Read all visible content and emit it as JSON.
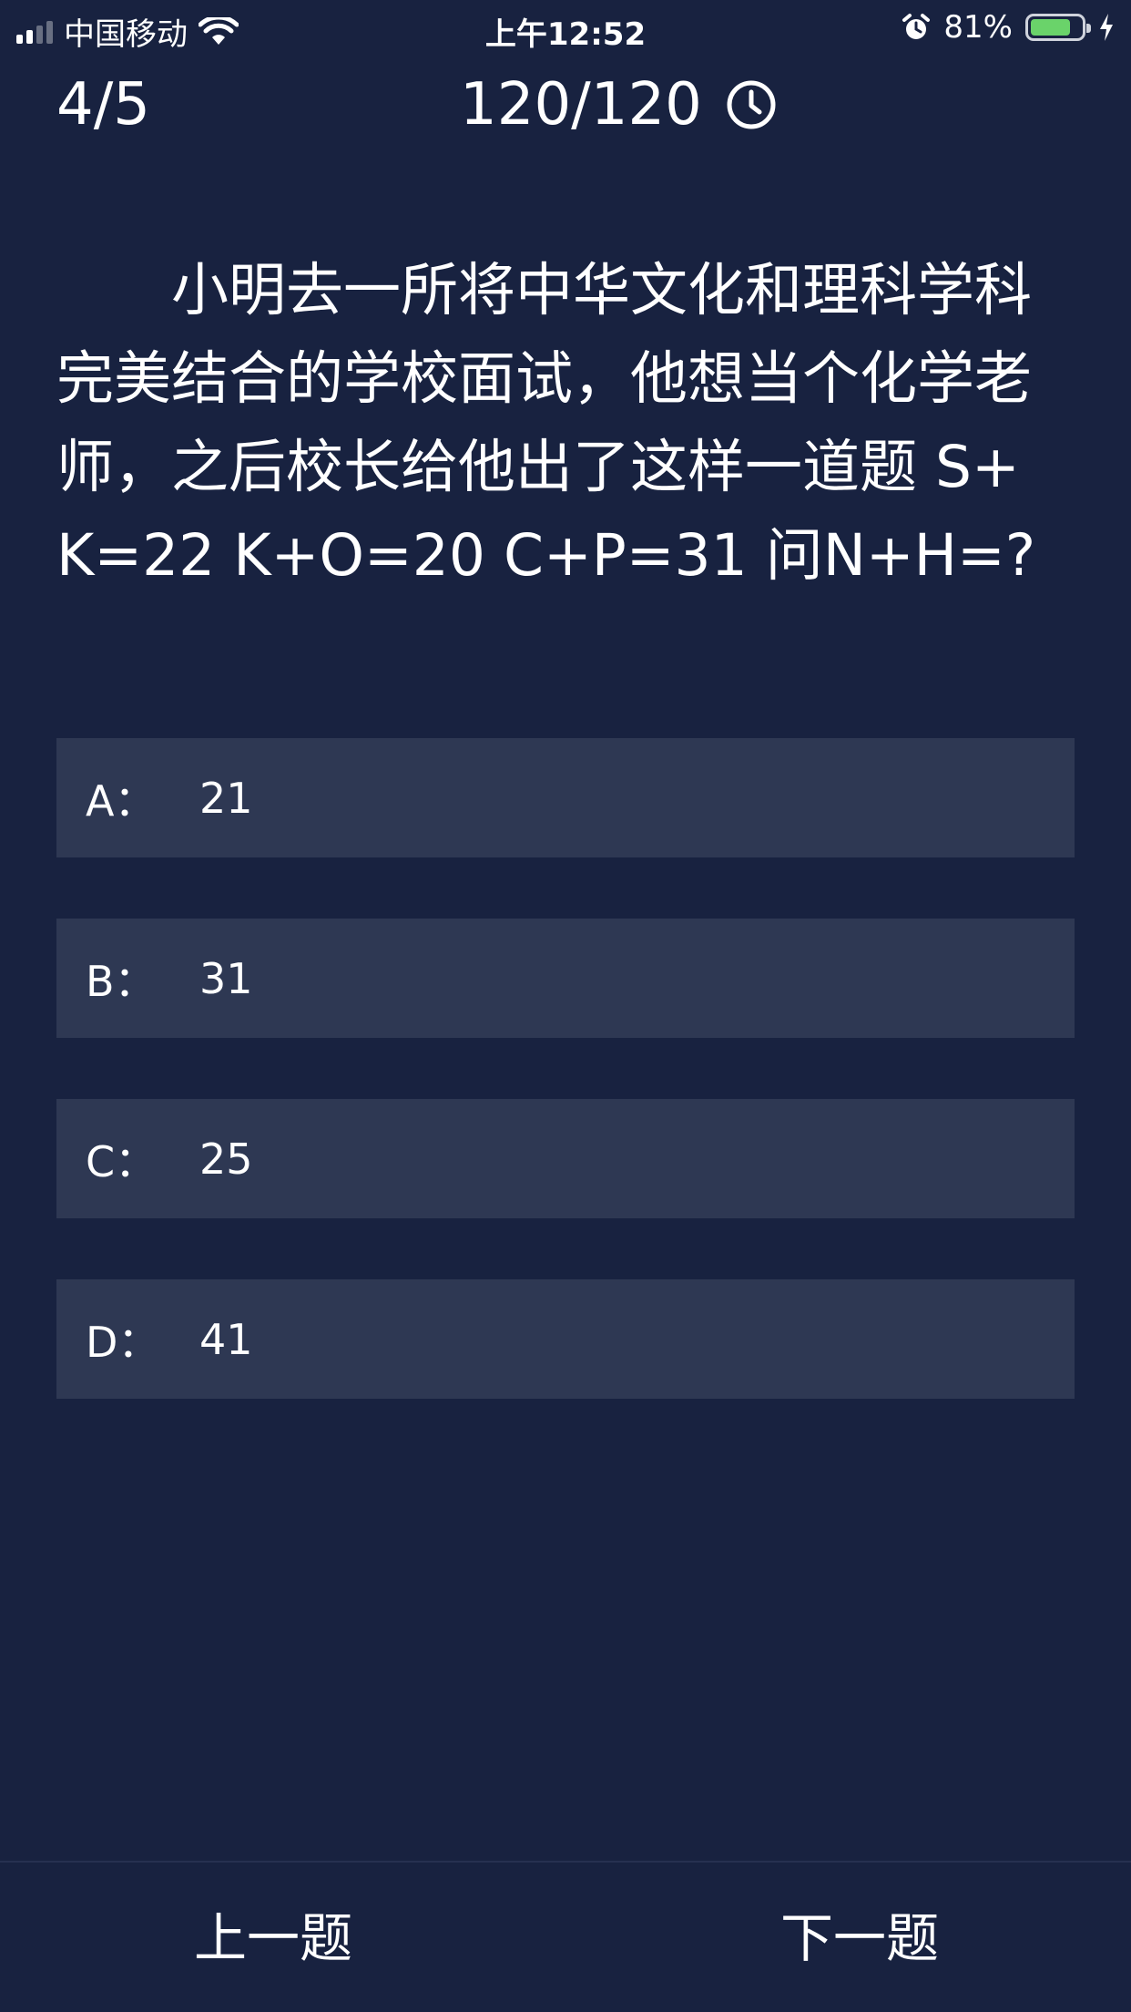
{
  "status_bar": {
    "carrier": "中国移动",
    "time": "上午12:52",
    "battery_percent_text": "81%",
    "battery_level": 0.81,
    "icons": [
      "signal-icon",
      "wifi-icon",
      "alarm-icon",
      "battery-icon",
      "charging-icon"
    ]
  },
  "header": {
    "progress": "4/5",
    "timer": "120/120",
    "timer_icon": "clock-icon"
  },
  "question": {
    "text": "小明去一所将中华文化和理科学科完美结合的学校面试，他想当个化学老师，之后校长给他出了这样一道题  S+K=22  K+O=20 C+P=31 问N+H=?"
  },
  "options": [
    {
      "letter": "A：",
      "value": "21"
    },
    {
      "letter": "B：",
      "value": "31"
    },
    {
      "letter": "C：",
      "value": "25"
    },
    {
      "letter": "D：",
      "value": "41"
    }
  ],
  "nav": {
    "prev_label": "上一题",
    "next_label": "下一题"
  },
  "colors": {
    "background": "#182240",
    "option_bg": "#2e3853",
    "battery_fill": "#6ad36a",
    "text": "#ffffff"
  }
}
